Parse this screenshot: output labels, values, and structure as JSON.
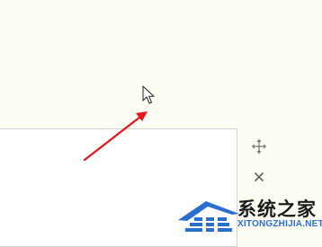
{
  "canvas": {
    "background": "#fdfdf4"
  },
  "text_box": {
    "value": ""
  },
  "icons": {
    "move": "move-arrows-icon",
    "close": "close-x-icon",
    "pointer": "mouse-pointer-icon"
  },
  "annotation": {
    "color": "#e8161a"
  },
  "watermark": {
    "title": "系统之家",
    "url": "XITONGZHIJIA.NET",
    "accent": "#2a6fd0"
  }
}
